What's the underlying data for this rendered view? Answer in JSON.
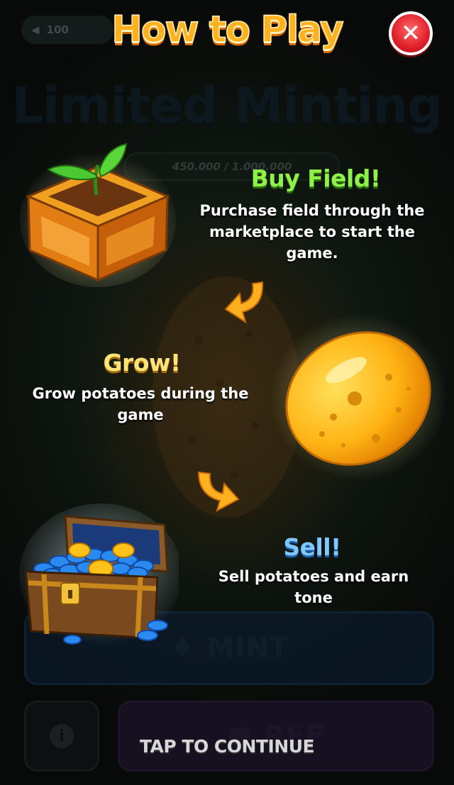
{
  "background_ui": {
    "back_value": "100",
    "title": "Limited Minting",
    "progress_text": "450.000 / 1.000.000",
    "mint_label": "MINT",
    "ref_label": "REF"
  },
  "overlay": {
    "title": "How to Play",
    "steps": [
      {
        "title": "Buy Field!",
        "description": "Purchase field through the marketplace to start the game."
      },
      {
        "title": "Grow!",
        "description": "Grow potatoes during the game"
      },
      {
        "title": "Sell!",
        "description": "Sell potatoes and earn tone"
      }
    ],
    "tap_label": "TAP TO CONTINUE"
  },
  "icons": [
    "close-icon",
    "field-crate-icon",
    "arrow-icon",
    "potato-icon",
    "treasure-chest-icon",
    "diamond-icon",
    "info-icon",
    "user-icon"
  ],
  "colors": {
    "title": "#ffb21e",
    "buy_field": "#8ff04a",
    "grow": "#ffe37a",
    "sell": "#7ec8ff",
    "close": "#e0202a"
  }
}
